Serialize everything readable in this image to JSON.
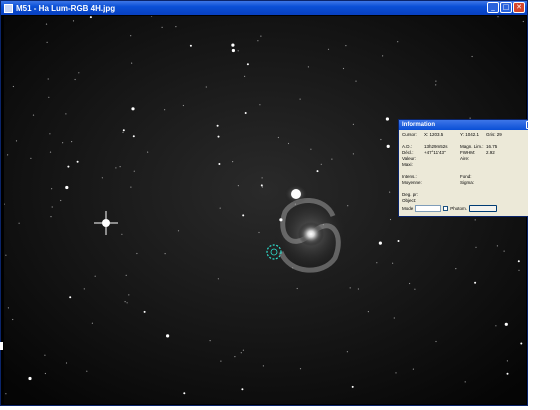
{
  "window": {
    "title": "M51 - Ha Lum-RGB 4H.jpg",
    "controls": {
      "minimize": "_",
      "maximize": "□",
      "close": "✕"
    }
  },
  "colors": {
    "titlebar": "#0a4fd6",
    "sky": "#0b0b0b",
    "marker": "#2ee0d0",
    "dialog_bg": "#ece9d8"
  },
  "icons": {
    "app": "image-icon",
    "marker": "selection-circle-icon"
  },
  "dialog": {
    "title": "Information",
    "controls": {
      "help": "?",
      "close": "✕"
    },
    "rows": [
      [
        "Cursor:",
        "X: 1203.5",
        "Y: 1042.1",
        "Gris: 29"
      ],
      [
        "",
        "",
        "",
        ""
      ],
      [
        "A.D.:",
        "13h29m52s",
        "Magn. Lim.:",
        "16.75"
      ],
      [
        "Décl.:",
        "+47°11'43\"",
        "FWHM:",
        "2.92"
      ],
      [
        "Valeur:",
        "",
        "Aire:",
        ""
      ],
      [
        "Maxi:",
        "",
        "",
        ""
      ],
      [
        "",
        "",
        "",
        ""
      ],
      [
        "Intens.:",
        "",
        "Fond:",
        ""
      ],
      [
        "Moyenne:",
        "",
        "Sigma:",
        ""
      ],
      [
        "",
        "",
        "",
        ""
      ],
      [
        "Deg. pr:",
        "",
        "",
        ""
      ],
      [
        "Object:",
        "",
        "",
        ""
      ]
    ],
    "bottom": {
      "label": "Mode",
      "option": "",
      "checkbox_label": "Photom.",
      "button": ""
    }
  }
}
